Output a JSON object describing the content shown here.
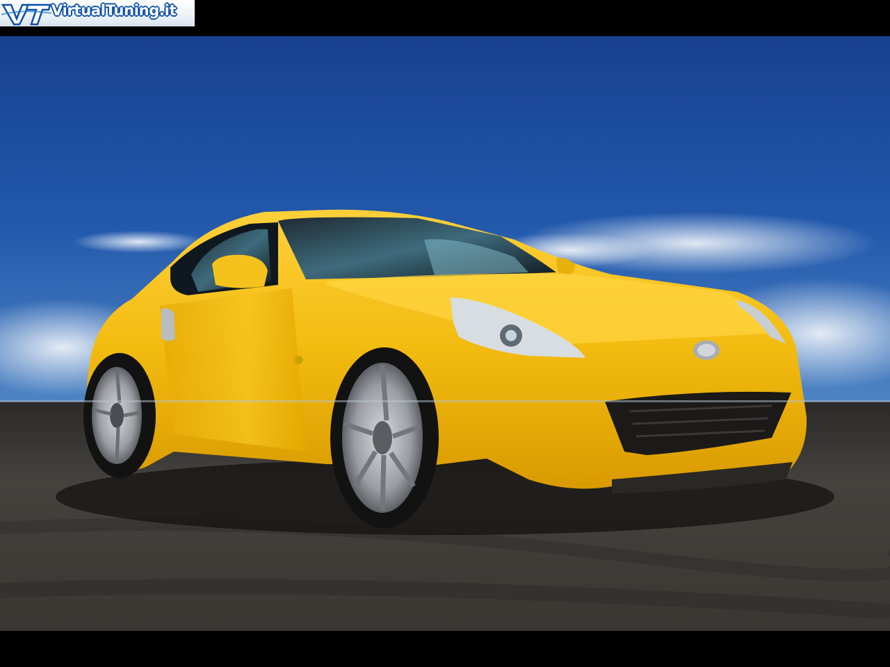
{
  "watermark": {
    "text": "VirtualTuning.it",
    "mark_letters": "VT",
    "brand_color": "#0b4fa8"
  },
  "photo": {
    "subject": "yellow sports coupe",
    "colors": {
      "sky": "#1d4fa2",
      "car_body": "#f2bd0f",
      "asphalt": "#3b3935",
      "frame": "#000000"
    }
  }
}
